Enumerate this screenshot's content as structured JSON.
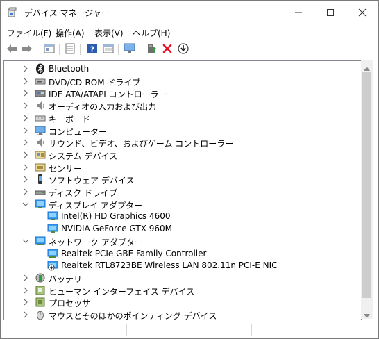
{
  "window": {
    "title": "デバイス マネージャー"
  },
  "menu": [
    "ファイル(F)",
    "操作(A)",
    "表示(V)",
    "ヘルプ(H)"
  ],
  "toolbar": {
    "buttons": [
      "back-icon",
      "forward-icon",
      "properties-icon",
      "list-icon",
      "help-icon",
      "view-icon",
      "monitor-scan-icon",
      "update-driver-icon",
      "uninstall-icon",
      "download-icon"
    ]
  },
  "tree": {
    "categories": [
      {
        "label": "Bluetooth",
        "icon": "bluetooth-icon",
        "expanded": false
      },
      {
        "label": "DVD/CD-ROM ドライブ",
        "icon": "dvd-drive-icon",
        "expanded": false
      },
      {
        "label": "IDE ATA/ATAPI コントローラー",
        "icon": "ide-controller-icon",
        "expanded": false
      },
      {
        "label": "オーディオの入力および出力",
        "icon": "speaker-icon",
        "expanded": false
      },
      {
        "label": "キーボード",
        "icon": "keyboard-icon",
        "expanded": false
      },
      {
        "label": "コンピューター",
        "icon": "computer-icon",
        "expanded": false
      },
      {
        "label": "サウンド、ビデオ、およびゲーム コントローラー",
        "icon": "sound-icon",
        "expanded": false
      },
      {
        "label": "システム デバイス",
        "icon": "system-device-icon",
        "expanded": false
      },
      {
        "label": "センサー",
        "icon": "sensor-icon",
        "expanded": false
      },
      {
        "label": "ソフトウェア デバイス",
        "icon": "software-device-icon",
        "expanded": false
      },
      {
        "label": "ディスク ドライブ",
        "icon": "disk-drive-icon",
        "expanded": false
      },
      {
        "label": "ディスプレイ アダプター",
        "icon": "display-adapter-icon",
        "expanded": true
      },
      {
        "label": "Intel(R) HD Graphics 4600",
        "icon": "display-adapter-icon",
        "child": true
      },
      {
        "label": "NVIDIA GeForce GTX 960M",
        "icon": "display-adapter-icon",
        "child": true
      },
      {
        "label": "ネットワーク アダプター",
        "icon": "network-adapter-icon",
        "expanded": true
      },
      {
        "label": "Realtek PCIe GBE Family Controller",
        "icon": "network-adapter-icon",
        "child": true
      },
      {
        "label": "Realtek RTL8723BE Wireless LAN 802.11n PCI-E NIC",
        "icon": "network-adapter-disabled-icon",
        "child": true
      },
      {
        "label": "バッテリ",
        "icon": "battery-icon",
        "expanded": false
      },
      {
        "label": "ヒューマン インターフェイス デバイス",
        "icon": "hid-icon",
        "expanded": false
      },
      {
        "label": "プロセッサ",
        "icon": "processor-icon",
        "expanded": false
      },
      {
        "label": "マウスとそのほかのポインティング デバイス",
        "icon": "mouse-icon",
        "expanded": false
      }
    ]
  },
  "colors": {
    "accent": "#1e6fd9",
    "error": "#e81123",
    "ok": "#2f9e3e"
  }
}
